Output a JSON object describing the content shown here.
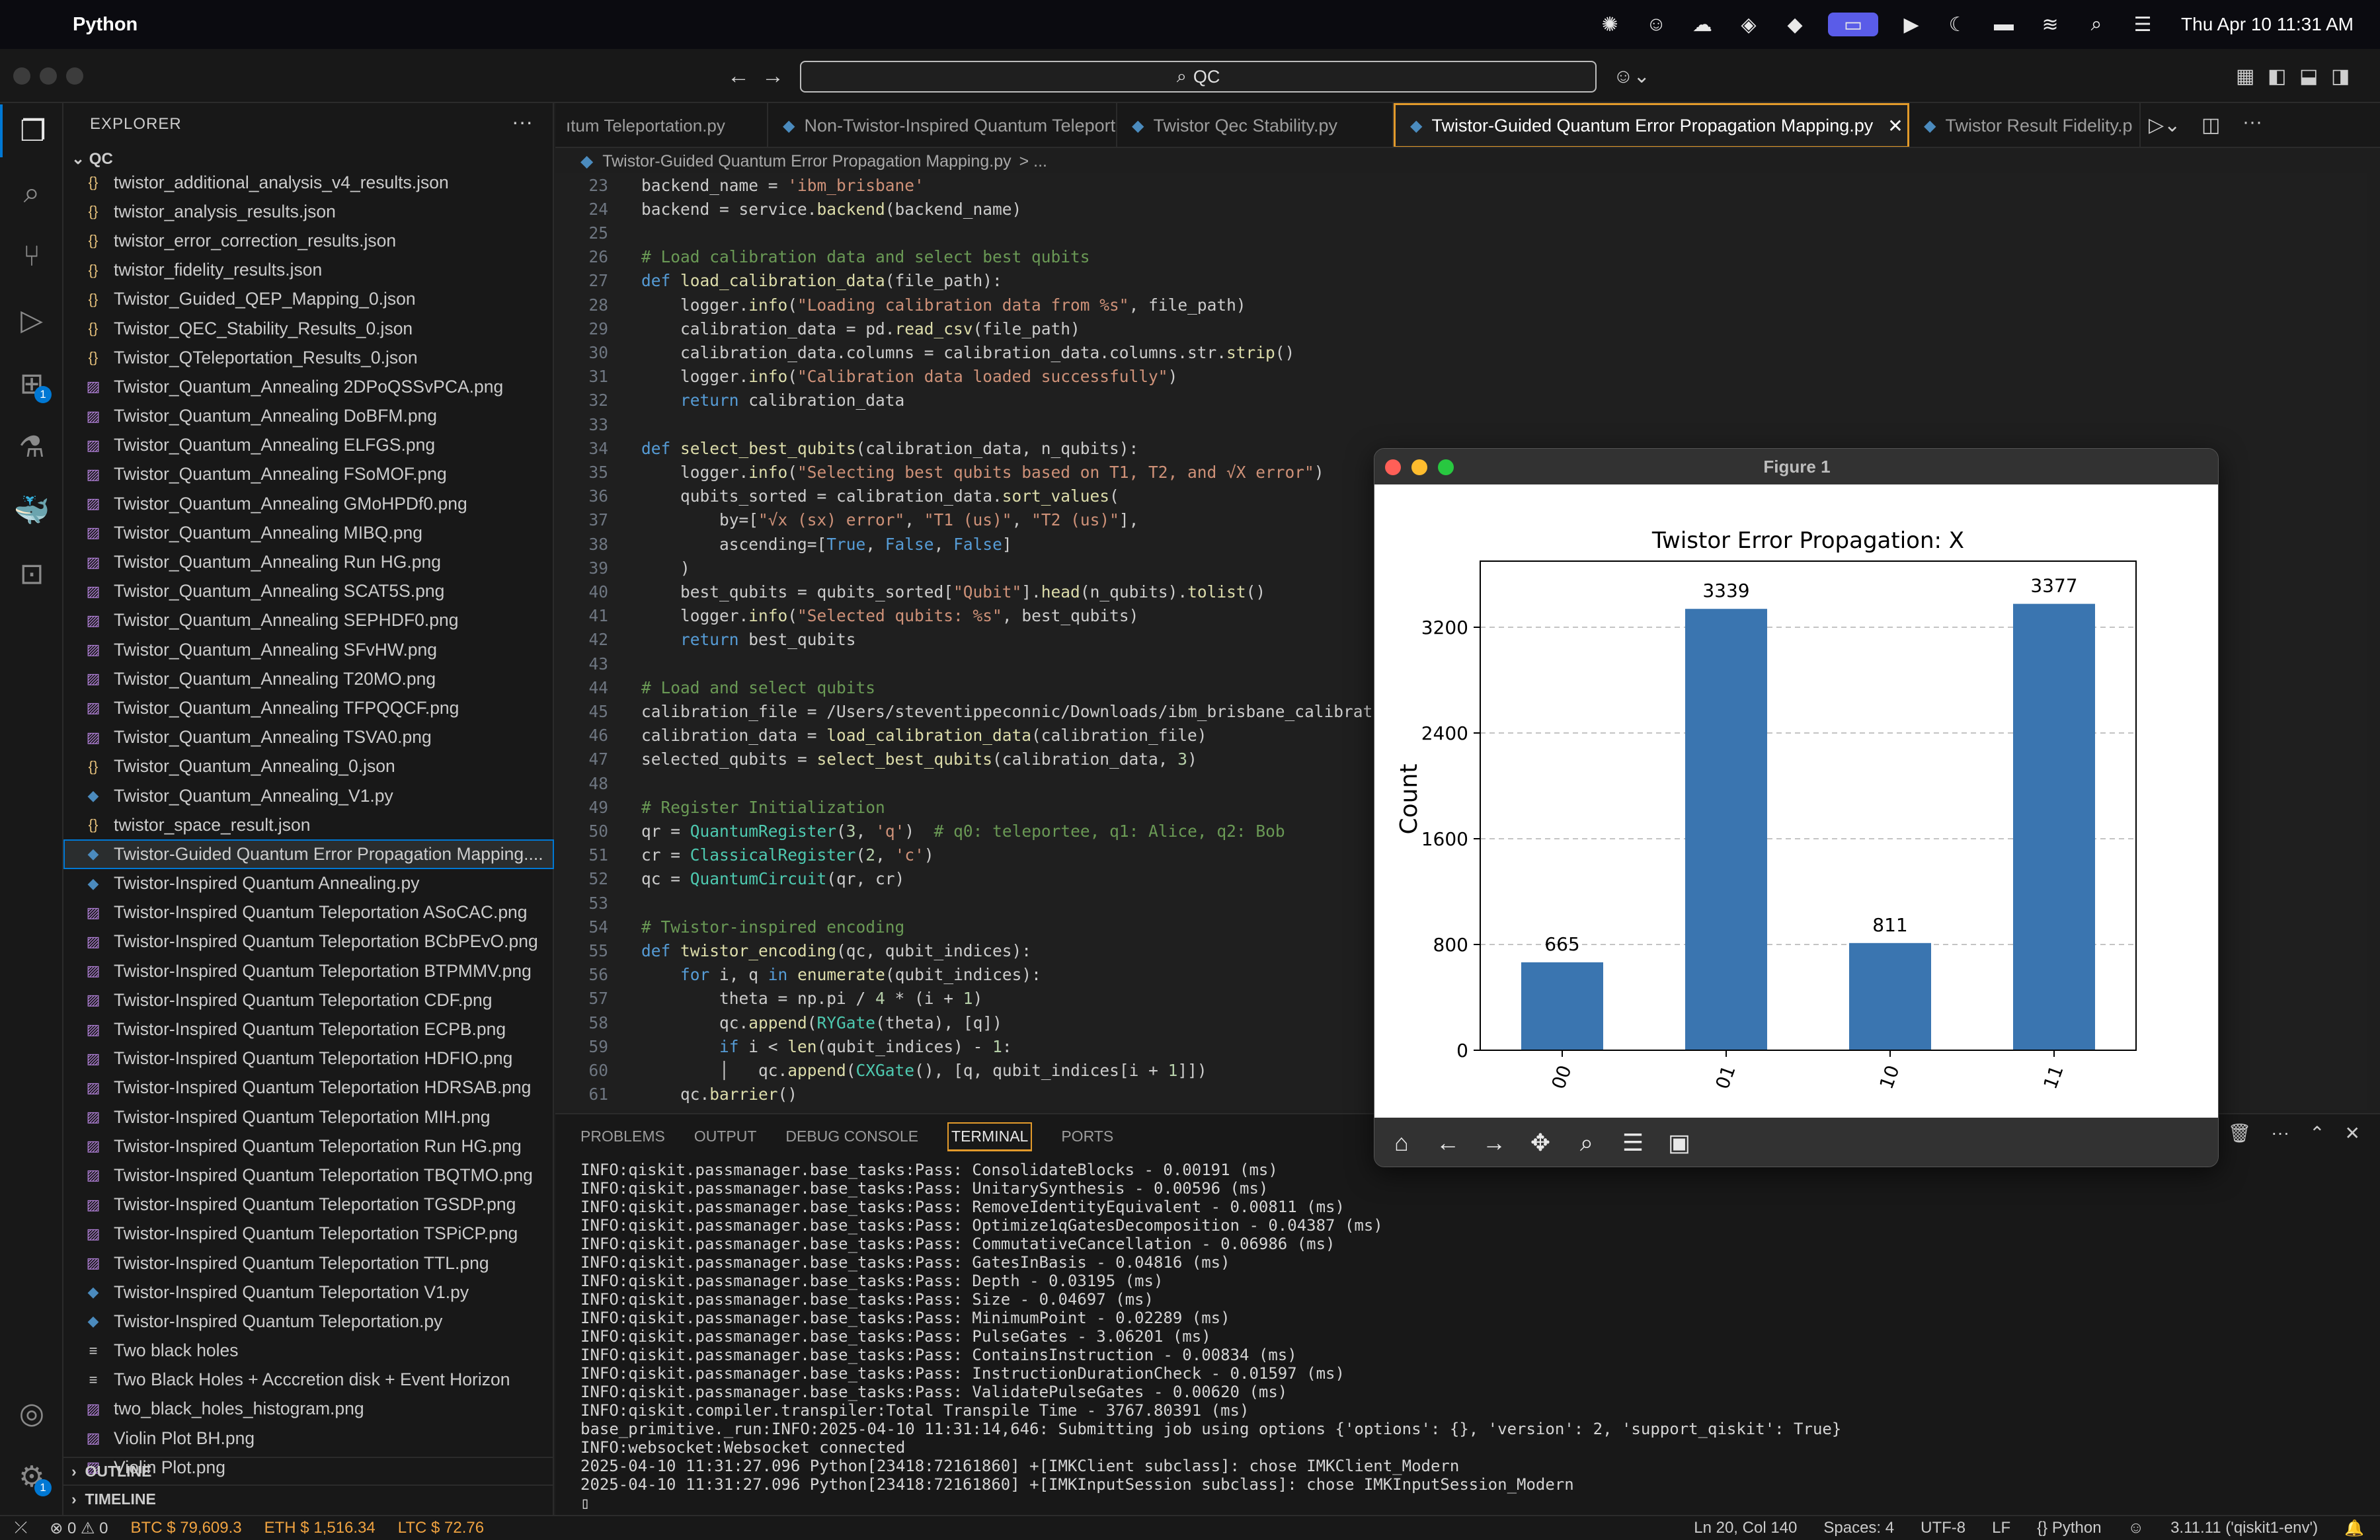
{
  "menubar": {
    "app_name": "Python",
    "clock": "Thu Apr 10  11:31 AM"
  },
  "command_center": {
    "text": "QC"
  },
  "explorer": {
    "header": "EXPLORER",
    "folder": "QC",
    "files": [
      {
        "name": "twistor_additional_analysis_v4_results.json",
        "type": "json"
      },
      {
        "name": "twistor_analysis_results.json",
        "type": "json"
      },
      {
        "name": "twistor_error_correction_results.json",
        "type": "json"
      },
      {
        "name": "twistor_fidelity_results.json",
        "type": "json"
      },
      {
        "name": "Twistor_Guided_QEP_Mapping_0.json",
        "type": "json"
      },
      {
        "name": "Twistor_QEC_Stability_Results_0.json",
        "type": "json"
      },
      {
        "name": "Twistor_QTeleportation_Results_0.json",
        "type": "json"
      },
      {
        "name": "Twistor_Quantum_Annealing 2DPoQSSvPCA.png",
        "type": "png"
      },
      {
        "name": "Twistor_Quantum_Annealing DoBFM.png",
        "type": "png"
      },
      {
        "name": "Twistor_Quantum_Annealing ELFGS.png",
        "type": "png"
      },
      {
        "name": "Twistor_Quantum_Annealing FSoMOF.png",
        "type": "png"
      },
      {
        "name": "Twistor_Quantum_Annealing GMoHPDf0.png",
        "type": "png"
      },
      {
        "name": "Twistor_Quantum_Annealing MIBQ.png",
        "type": "png"
      },
      {
        "name": "Twistor_Quantum_Annealing Run HG.png",
        "type": "png"
      },
      {
        "name": "Twistor_Quantum_Annealing SCAT5S.png",
        "type": "png"
      },
      {
        "name": "Twistor_Quantum_Annealing SEPHDF0.png",
        "type": "png"
      },
      {
        "name": "Twistor_Quantum_Annealing SFvHW.png",
        "type": "png"
      },
      {
        "name": "Twistor_Quantum_Annealing T20MO.png",
        "type": "png"
      },
      {
        "name": "Twistor_Quantum_Annealing TFPQQCF.png",
        "type": "png"
      },
      {
        "name": "Twistor_Quantum_Annealing TSVA0.png",
        "type": "png"
      },
      {
        "name": "Twistor_Quantum_Annealing_0.json",
        "type": "json"
      },
      {
        "name": "Twistor_Quantum_Annealing_V1.py",
        "type": "py"
      },
      {
        "name": "twistor_space_result.json",
        "type": "json"
      },
      {
        "name": "Twistor-Guided Quantum Error Propagation Mapping....",
        "type": "py",
        "selected": true
      },
      {
        "name": "Twistor-Inspired Quantum Annealing.py",
        "type": "py"
      },
      {
        "name": "Twistor-Inspired Quantum Teleportation ASoCAC.png",
        "type": "png"
      },
      {
        "name": "Twistor-Inspired Quantum Teleportation BCbPEvO.png",
        "type": "png"
      },
      {
        "name": "Twistor-Inspired Quantum Teleportation BTPMMV.png",
        "type": "png"
      },
      {
        "name": "Twistor-Inspired Quantum Teleportation CDF.png",
        "type": "png"
      },
      {
        "name": "Twistor-Inspired Quantum Teleportation ECPB.png",
        "type": "png"
      },
      {
        "name": "Twistor-Inspired Quantum Teleportation HDFIO.png",
        "type": "png"
      },
      {
        "name": "Twistor-Inspired Quantum Teleportation HDRSAB.png",
        "type": "png"
      },
      {
        "name": "Twistor-Inspired Quantum Teleportation MIH.png",
        "type": "png"
      },
      {
        "name": "Twistor-Inspired Quantum Teleportation Run HG.png",
        "type": "png"
      },
      {
        "name": "Twistor-Inspired Quantum Teleportation TBQTMO.png",
        "type": "png"
      },
      {
        "name": "Twistor-Inspired Quantum Teleportation TGSDP.png",
        "type": "png"
      },
      {
        "name": "Twistor-Inspired Quantum Teleportation TSPiCP.png",
        "type": "png"
      },
      {
        "name": "Twistor-Inspired Quantum Teleportation TTL.png",
        "type": "png"
      },
      {
        "name": "Twistor-Inspired Quantum Teleportation V1.py",
        "type": "py"
      },
      {
        "name": "Twistor-Inspired Quantum Teleportation.py",
        "type": "py"
      },
      {
        "name": "Two black holes",
        "type": "txt"
      },
      {
        "name": "Two Black Holes + Acccretion disk + Event Horizon",
        "type": "txt"
      },
      {
        "name": "two_black_holes_histogram.png",
        "type": "png"
      },
      {
        "name": "Violin Plot BH.png",
        "type": "png"
      },
      {
        "name": "Violin Plot.png",
        "type": "png"
      }
    ],
    "sections": [
      "OUTLINE",
      "TIMELINE"
    ]
  },
  "tabs": [
    {
      "label": "ıtum Teleportation.py"
    },
    {
      "label": "Non-Twistor-Inspired Quantum Teleportation.py"
    },
    {
      "label": "Twistor Qec Stability.py"
    },
    {
      "label": "Twistor-Guided Quantum Error Propagation Mapping.py",
      "active": true
    },
    {
      "label": "Twistor Result Fidelity.p"
    }
  ],
  "breadcrumb": {
    "file": "Twistor-Guided Quantum Error Propagation Mapping.py",
    "rest": "> ..."
  },
  "editor": {
    "lines": [
      {
        "n": "23",
        "code": "backend_name = 'ibm_brisbane'"
      },
      {
        "n": "24",
        "code": "backend = service.backend(backend_name)"
      },
      {
        "n": "25",
        "code": ""
      },
      {
        "n": "26",
        "code": "# Load calibration data and select best qubits"
      },
      {
        "n": "27",
        "code": "def load_calibration_data(file_path):"
      },
      {
        "n": "28",
        "code": "    logger.info(\"Loading calibration data from %s\", file_path)"
      },
      {
        "n": "29",
        "code": "    calibration_data = pd.read_csv(file_path)"
      },
      {
        "n": "30",
        "code": "    calibration_data.columns = calibration_data.columns.str.strip()"
      },
      {
        "n": "31",
        "code": "    logger.info(\"Calibration data loaded successfully\")"
      },
      {
        "n": "32",
        "code": "    return calibration_data"
      },
      {
        "n": "33",
        "code": ""
      },
      {
        "n": "34",
        "code": "def select_best_qubits(calibration_data, n_qubits):"
      },
      {
        "n": "35",
        "code": "    logger.info(\"Selecting best qubits based on T1, T2, and √X error\")"
      },
      {
        "n": "36",
        "code": "    qubits_sorted = calibration_data.sort_values("
      },
      {
        "n": "37",
        "code": "        by=[\"√x (sx) error\", \"T1 (us)\", \"T2 (us)\"],"
      },
      {
        "n": "38",
        "code": "        ascending=[True, False, False]"
      },
      {
        "n": "39",
        "code": "    )"
      },
      {
        "n": "40",
        "code": "    best_qubits = qubits_sorted[\"Qubit\"].head(n_qubits).tolist()"
      },
      {
        "n": "41",
        "code": "    logger.info(\"Selected qubits: %s\", best_qubits)"
      },
      {
        "n": "42",
        "code": "    return best_qubits"
      },
      {
        "n": "43",
        "code": ""
      },
      {
        "n": "44",
        "code": "# Load and select qubits"
      },
      {
        "n": "45",
        "code": "calibration_file = '/Users/steventippeconnic/Downloads/ibm_brisbane_calibrati"
      },
      {
        "n": "46",
        "code": "calibration_data = load_calibration_data(calibration_file)"
      },
      {
        "n": "47",
        "code": "selected_qubits = select_best_qubits(calibration_data, 3)"
      },
      {
        "n": "48",
        "code": ""
      },
      {
        "n": "49",
        "code": "# Register Initialization"
      },
      {
        "n": "50",
        "code": "qr = QuantumRegister(3, 'q')  # q0: teleportee, q1: Alice, q2: Bob"
      },
      {
        "n": "51",
        "code": "cr = ClassicalRegister(2, 'c')"
      },
      {
        "n": "52",
        "code": "qc = QuantumCircuit(qr, cr)"
      },
      {
        "n": "53",
        "code": ""
      },
      {
        "n": "54",
        "code": "# Twistor-inspired encoding"
      },
      {
        "n": "55",
        "code": "def twistor_encoding(qc, qubit_indices):"
      },
      {
        "n": "56",
        "code": "    for i, q in enumerate(qubit_indices):"
      },
      {
        "n": "57",
        "code": "        theta = np.pi / 4 * (i + 1)"
      },
      {
        "n": "58",
        "code": "        qc.append(RYGate(theta), [q])"
      },
      {
        "n": "59",
        "code": "        if i < len(qubit_indices) - 1:"
      },
      {
        "n": "60",
        "code": "        │   qc.append(CXGate(), [q, qubit_indices[i + 1]])"
      },
      {
        "n": "61",
        "code": "    qc.barrier()"
      }
    ]
  },
  "panel": {
    "tabs": [
      "PROBLEMS",
      "OUTPUT",
      "DEBUG CONSOLE",
      "TERMINAL",
      "PORTS"
    ],
    "active_tab": "TERMINAL",
    "terminal": [
      "INFO:qiskit.passmanager.base_tasks:Pass: ConsolidateBlocks - 0.00191 (ms)",
      "INFO:qiskit.passmanager.base_tasks:Pass: UnitarySynthesis - 0.00596 (ms)",
      "INFO:qiskit.passmanager.base_tasks:Pass: RemoveIdentityEquivalent - 0.00811 (ms)",
      "INFO:qiskit.passmanager.base_tasks:Pass: Optimize1qGatesDecomposition - 0.04387 (ms)",
      "INFO:qiskit.passmanager.base_tasks:Pass: CommutativeCancellation - 0.06986 (ms)",
      "INFO:qiskit.passmanager.base_tasks:Pass: GatesInBasis - 0.04816 (ms)",
      "INFO:qiskit.passmanager.base_tasks:Pass: Depth - 0.03195 (ms)",
      "INFO:qiskit.passmanager.base_tasks:Pass: Size - 0.04697 (ms)",
      "INFO:qiskit.passmanager.base_tasks:Pass: MinimumPoint - 0.02289 (ms)",
      "INFO:qiskit.passmanager.base_tasks:Pass: PulseGates - 3.06201 (ms)",
      "INFO:qiskit.passmanager.base_tasks:Pass: ContainsInstruction - 0.00834 (ms)",
      "INFO:qiskit.passmanager.base_tasks:Pass: InstructionDurationCheck - 0.01597 (ms)",
      "INFO:qiskit.passmanager.base_tasks:Pass: ValidatePulseGates - 0.00620 (ms)",
      "INFO:qiskit.compiler.transpiler:Total Transpile Time - 3767.80391 (ms)",
      "base_primitive._run:INFO:2025-04-10 11:31:14,646: Submitting job using options {'options': {}, 'version': 2, 'support_qiskit': True}",
      "INFO:websocket:Websocket connected",
      "2025-04-10 11:31:27.096 Python[23418:72161860] +[IMKClient subclass]: chose IMKClient_Modern",
      "2025-04-10 11:31:27.096 Python[23418:72161860] +[IMKInputSession subclass]: chose IMKInputSession_Modern",
      "▯"
    ]
  },
  "statusbar": {
    "problems": "⊗ 0 ⚠ 0",
    "btc": "BTC $ 79,609.3",
    "eth": "ETH $ 1,516.34",
    "ltc": "LTC $ 72.76",
    "position": "Ln 20, Col 140",
    "spaces": "Spaces: 4",
    "encoding": "UTF-8",
    "eol": "LF",
    "language": "{} Python",
    "interpreter": "3.11.11 ('qiskit1-env')"
  },
  "figure": {
    "window_title": "Figure 1",
    "accent": "#3a75b0"
  },
  "chart_data": {
    "type": "bar",
    "title": "Twistor Error Propagation: X",
    "xlabel": "",
    "ylabel": "Count",
    "categories": [
      "00",
      "01",
      "10",
      "11"
    ],
    "values": [
      665,
      3339,
      811,
      3377
    ],
    "yticks": [
      0,
      800,
      1600,
      2400,
      3200
    ],
    "ylim": [
      0,
      3700
    ],
    "grid": "y-dashed",
    "bar_color": "#3a75b0"
  }
}
